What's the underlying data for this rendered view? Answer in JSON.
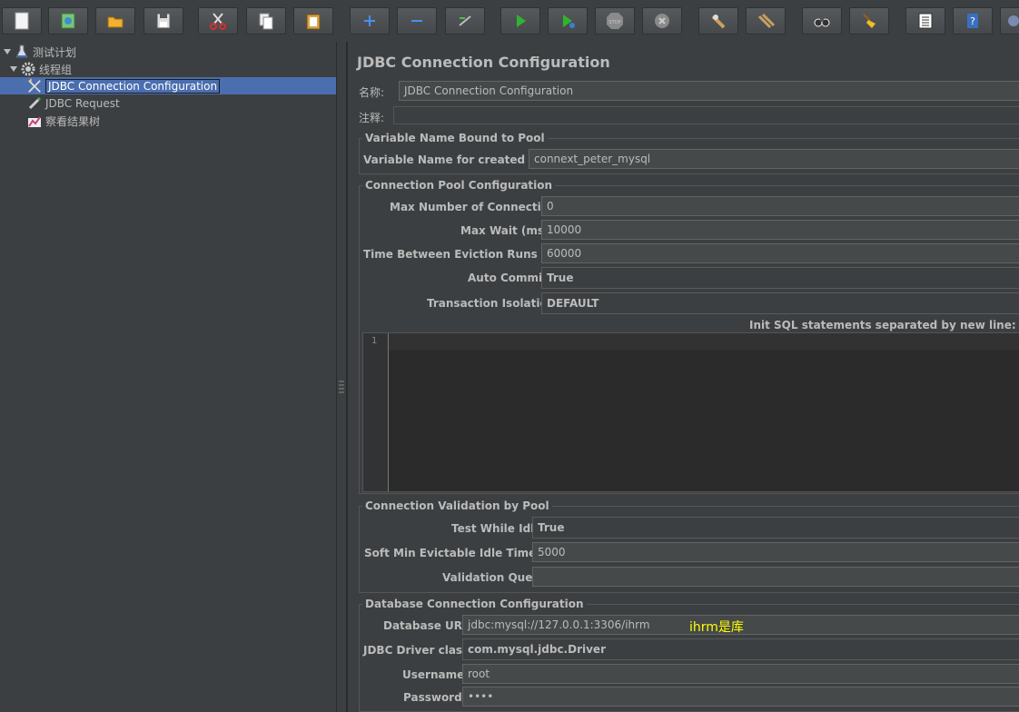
{
  "toolbar": {
    "buttons": [
      {
        "icon": "new-file-icon"
      },
      {
        "icon": "templates-icon"
      },
      {
        "icon": "open-folder-icon"
      },
      {
        "icon": "save-icon"
      },
      {
        "icon": "cut-icon"
      },
      {
        "icon": "copy-icon"
      },
      {
        "icon": "paste-icon"
      },
      {
        "icon": "expand-plus-icon"
      },
      {
        "icon": "collapse-minus-icon"
      },
      {
        "icon": "toggle-icon"
      },
      {
        "icon": "start-icon"
      },
      {
        "icon": "start-no-timers-icon"
      },
      {
        "icon": "stop-icon"
      },
      {
        "icon": "shutdown-icon"
      },
      {
        "icon": "clear-icon"
      },
      {
        "icon": "clear-all-icon"
      },
      {
        "icon": "search-binoculars-icon"
      },
      {
        "icon": "reset-search-broom-icon"
      },
      {
        "icon": "function-helper-icon"
      },
      {
        "icon": "help-icon"
      },
      {
        "icon": "more-icon"
      }
    ]
  },
  "tree": {
    "test_plan": "测试计划",
    "thread_group": "线程组",
    "jdbc_config": "JDBC Connection Configuration",
    "jdbc_request": "JDBC Request",
    "result_tree": "察看结果树"
  },
  "panel": {
    "title": "JDBC Connection Configuration",
    "name_label": "名称:",
    "name_value": "JDBC Connection Configuration",
    "comment_label": "注释:",
    "comment_value": "",
    "var_section": "Variable Name Bound to Pool",
    "var_label": "Variable Name for created pool:",
    "var_value": "connext_peter_mysql",
    "pool_section": "Connection Pool Configuration",
    "max_conn_label": "Max Number of Connections:",
    "max_conn_value": "0",
    "max_wait_label": "Max Wait (ms):",
    "max_wait_value": "10000",
    "eviction_label": "Time Between Eviction Runs (ms):",
    "eviction_value": "60000",
    "auto_commit_label": "Auto Commit:",
    "auto_commit_value": "True",
    "isolation_label": "Transaction Isolation:",
    "isolation_value": "DEFAULT",
    "init_sql_label": "Init SQL statements separated by new line:",
    "sql_line_number": "1",
    "validation_section": "Connection Validation by Pool",
    "test_idle_label": "Test While Idle:",
    "test_idle_value": "True",
    "soft_min_label": "Soft Min Evictable Idle Time(ms):",
    "soft_min_value": "5000",
    "validation_query_label": "Validation Query:",
    "validation_query_value": "",
    "db_section": "Database Connection Configuration",
    "url_label": "Database URL:",
    "url_value": "jdbc:mysql://127.0.0.1:3306/ihrm",
    "url_annotation": "ihrm是库",
    "driver_label": "JDBC Driver class:",
    "driver_value": "com.mysql.jdbc.Driver",
    "username_label": "Username:",
    "username_value": "root",
    "password_label": "Password:",
    "password_value": "••••"
  },
  "colors": {
    "background": "#3c3f41",
    "selection": "#4b6eaf",
    "field": "#45494a",
    "annotation": "#ffff00"
  }
}
